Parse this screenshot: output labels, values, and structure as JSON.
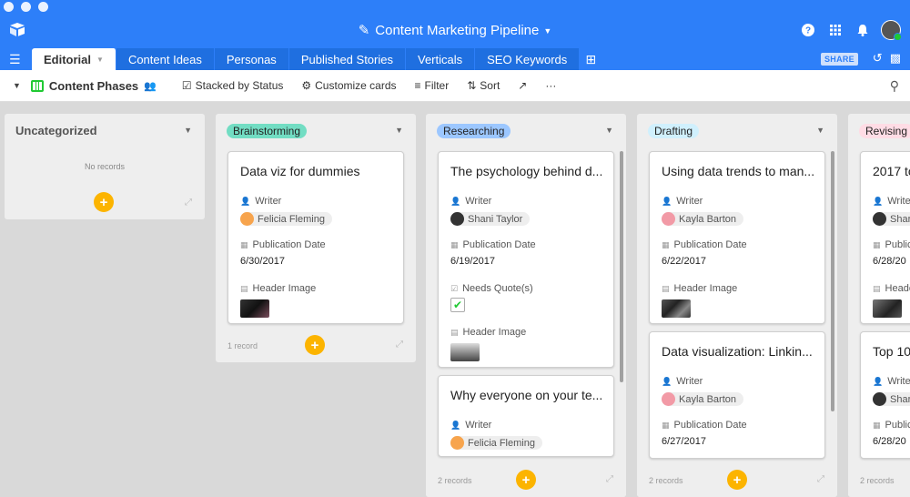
{
  "app": {
    "base_title": "Content Marketing Pipeline",
    "share_label": "SHARE"
  },
  "tabs": [
    {
      "label": "Editorial",
      "active": true
    },
    {
      "label": "Content Ideas"
    },
    {
      "label": "Personas"
    },
    {
      "label": "Published Stories"
    },
    {
      "label": "Verticals"
    },
    {
      "label": "SEO Keywords"
    }
  ],
  "toolbar": {
    "view_name": "Content Phases",
    "stacked": "Stacked by Status",
    "customize": "Customize cards",
    "filter": "Filter",
    "sort": "Sort",
    "more": "···"
  },
  "fields": {
    "writer": "Writer",
    "pub_date": "Publication Date",
    "header_image": "Header Image",
    "needs_quotes": "Needs Quote(s)"
  },
  "stacks": {
    "uncategorized": {
      "label": "Uncategorized",
      "empty": "No records"
    },
    "brainstorming": {
      "label": "Brainstorming",
      "color": "#72ddc3",
      "count": "1 record"
    },
    "researching": {
      "label": "Researching",
      "color": "#9cc7ff",
      "count": "2 records"
    },
    "drafting": {
      "label": "Drafting",
      "color": "#d0f0fd",
      "count": "2 records"
    },
    "revising": {
      "label": "Revising",
      "color": "#ffdce5",
      "count": "2 records"
    }
  },
  "cards": {
    "b1": {
      "title": "Data viz for dummies",
      "writer": "Felicia Fleming",
      "date": "6/30/2017"
    },
    "r1": {
      "title": "The psychology behind d...",
      "writer": "Shani Taylor",
      "date": "6/19/2017",
      "needs_quotes": true
    },
    "r2": {
      "title": "Why everyone on your te...",
      "writer": "Felicia Fleming"
    },
    "d1": {
      "title": "Using data trends to man...",
      "writer": "Kayla Barton",
      "date": "6/22/2017"
    },
    "d2": {
      "title": "Data visualization: Linkin...",
      "writer": "Kayla Barton",
      "date": "6/27/2017"
    },
    "v1": {
      "title": "2017 to",
      "writer": "Shar",
      "date": "6/28/20"
    },
    "v2": {
      "title": "Top 10",
      "writer": "Shar",
      "date": "6/28/20"
    }
  },
  "colors": {
    "accent": "#2d7ff9",
    "add_button": "#fcb400"
  }
}
